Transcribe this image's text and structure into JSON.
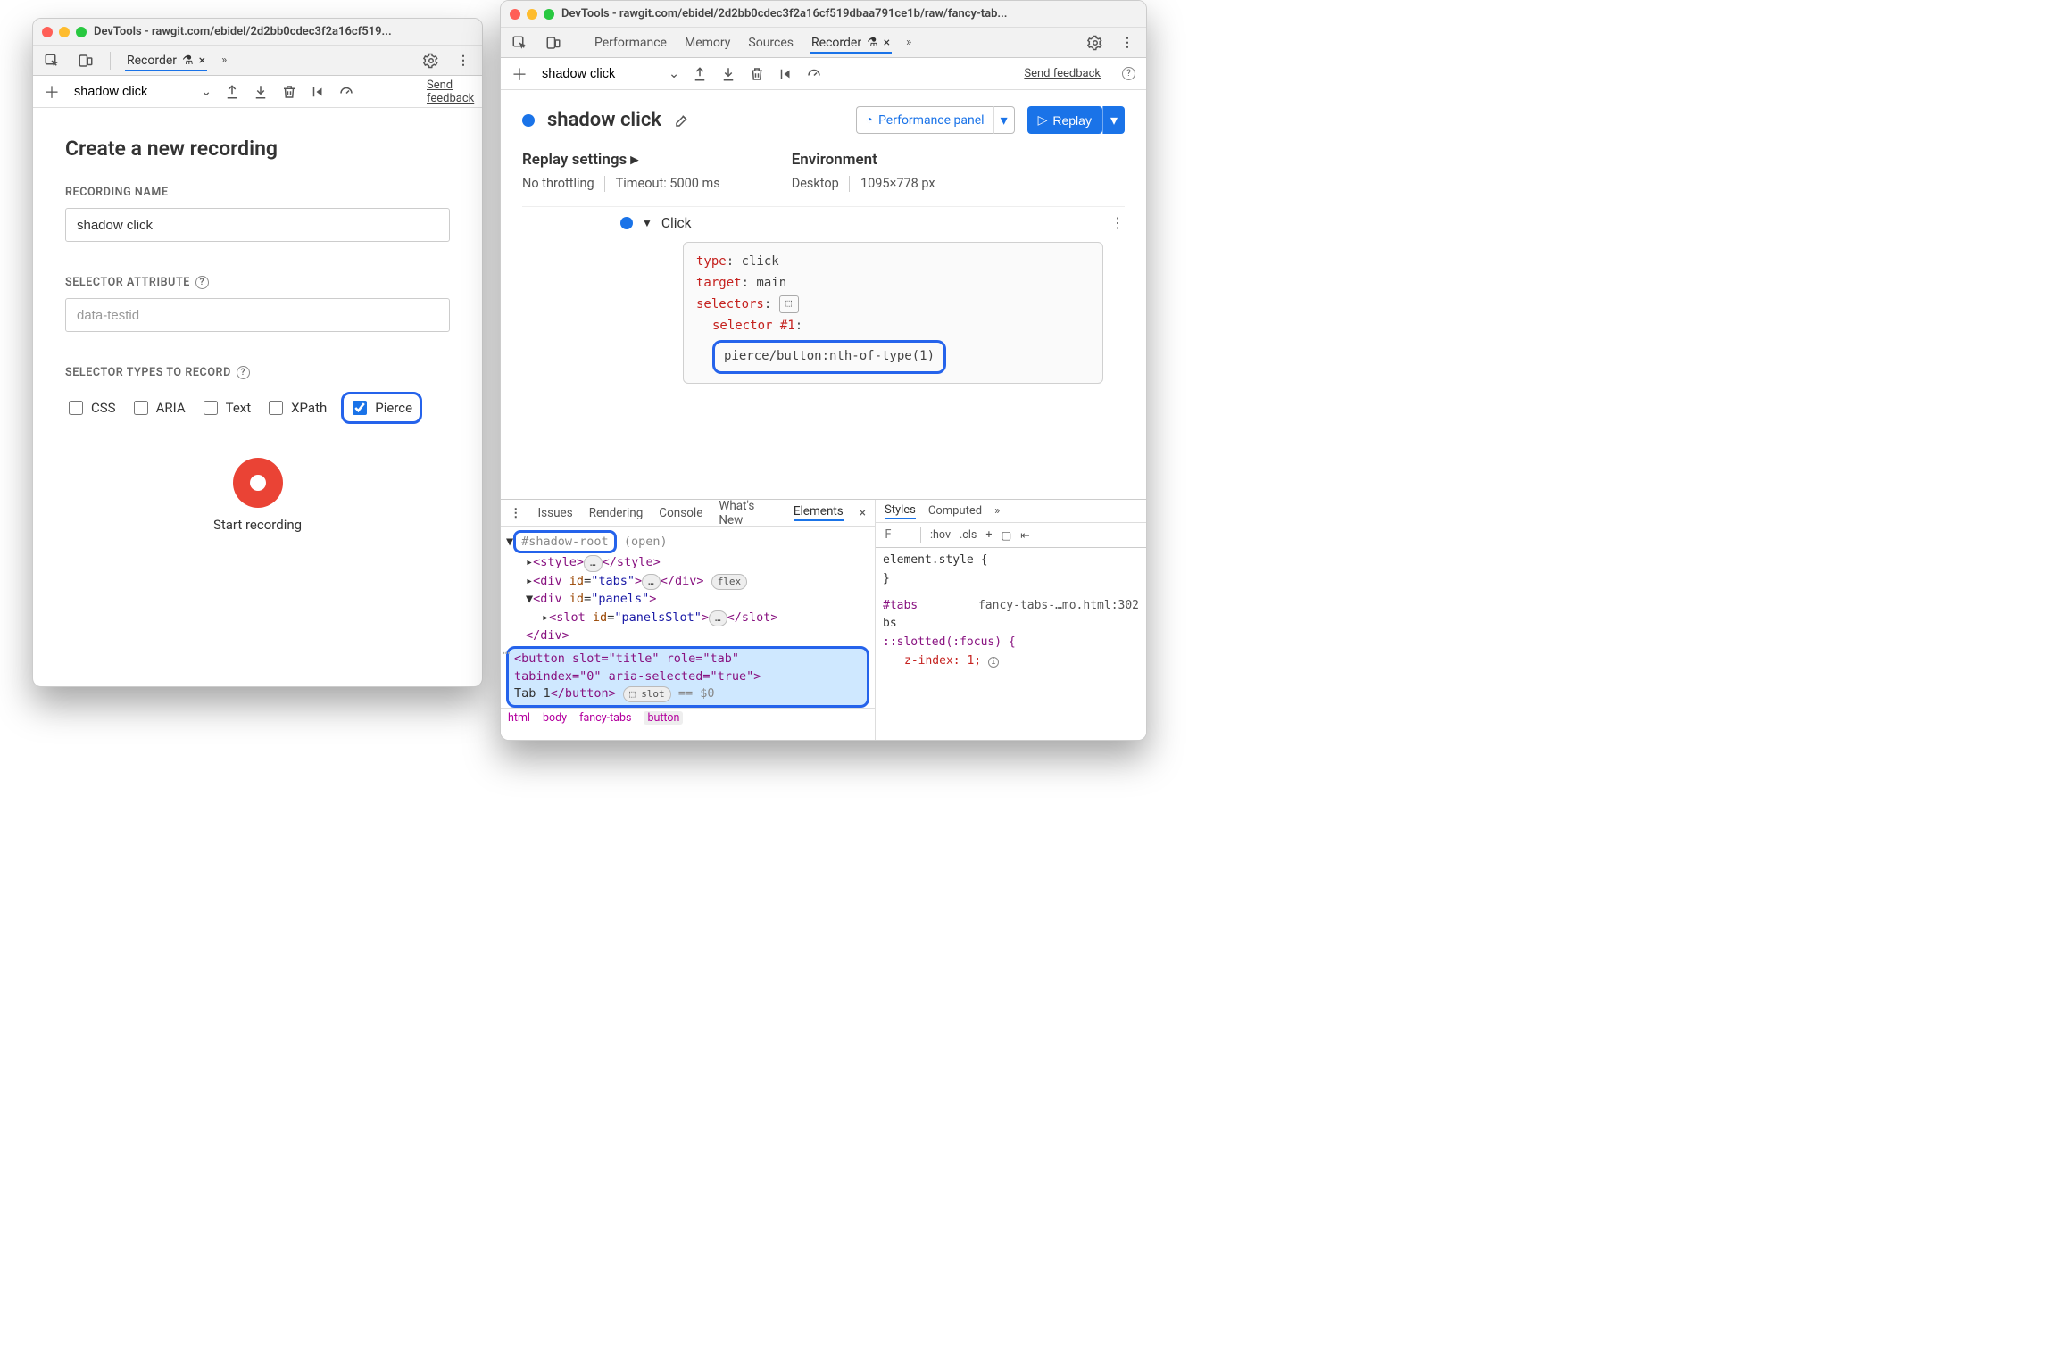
{
  "left": {
    "title": "DevTools - rawgit.com/ebidel/2d2bb0cdec3f2a16cf519...",
    "tabs": {
      "recorder": "Recorder"
    },
    "toolbar": {
      "name": "shadow click",
      "send": "Send feedback"
    },
    "form": {
      "heading": "Create a new recording",
      "name_label": "RECORDING NAME",
      "name_value": "shadow click",
      "sel_attr_label": "SELECTOR ATTRIBUTE",
      "sel_attr_placeholder": "data-testid",
      "types_label": "SELECTOR TYPES TO RECORD",
      "types": {
        "css": "CSS",
        "aria": "ARIA",
        "text": "Text",
        "xpath": "XPath",
        "pierce": "Pierce"
      },
      "start": "Start recording"
    }
  },
  "right": {
    "title": "DevTools - rawgit.com/ebidel/2d2bb0cdec3f2a16cf519dbaa791ce1b/raw/fancy-tab...",
    "tabs": {
      "perf": "Performance",
      "memory": "Memory",
      "sources": "Sources",
      "recorder": "Recorder"
    },
    "toolbar": {
      "name": "shadow click",
      "send": "Send feedback"
    },
    "header": {
      "title": "shadow click",
      "perf_panel": "Performance panel",
      "replay": "Replay"
    },
    "settings": {
      "h": "Replay settings",
      "throttle": "No throttling",
      "timeout": "Timeout: 5000 ms",
      "env_h": "Environment",
      "env_device": "Desktop",
      "env_dims": "1095×778 px"
    },
    "step": {
      "name": "Click",
      "kv": {
        "type_k": "type",
        "type_v": ": click",
        "target_k": "target",
        "target_v": ": main",
        "selectors_k": "selectors",
        "selectors_v": ":",
        "sel_num": "selector #1",
        "selector": "pierce/button:nth-of-type(1)"
      }
    },
    "drawer": {
      "tabs": {
        "issues": "Issues",
        "rendering": "Rendering",
        "console": "Console",
        "whatsnew": "What's New",
        "elements": "Elements"
      },
      "shadow_root": "#shadow-root",
      "shadow_open": "(open)",
      "node_tabs_id": "tabs",
      "node_panels_id": "panels",
      "node_slot_id": "panelsSlot",
      "button_line1": "<button slot=\"title\" role=\"tab\"",
      "button_line2": "tabindex=\"0\" aria-selected=\"true\">",
      "button_text": "Tab 1",
      "button_close": "</button>",
      "slot_badge": "slot",
      "eq": " == $0",
      "crumbs": {
        "html": "html",
        "body": "body",
        "ft": "fancy-tabs",
        "button": "button"
      },
      "flex_badge": "flex",
      "ellips": "…",
      "styles": {
        "tabs": {
          "styles": "Styles",
          "computed": "Computed"
        },
        "filter_ph": "F",
        "hov": ":hov",
        "cls": ".cls",
        "plus": "+",
        "elem_style": "element.style {",
        "close": "}",
        "sel": "#tabs",
        "srclink": "fancy-tabs-…mo.html:302",
        "slotted": "::slotted(:focus) {",
        "zidx": "z-index",
        "zidx_v": ": 1;"
      }
    }
  }
}
